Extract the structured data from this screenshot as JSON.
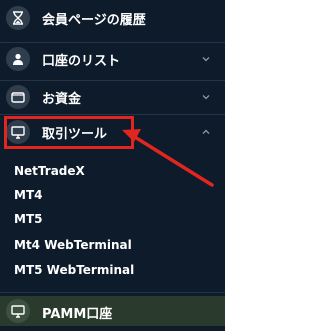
{
  "menu": {
    "items": [
      {
        "label": "会員ページの履歴",
        "icon": "hourglass-icon",
        "chevron": "none"
      },
      {
        "label": "口座のリスト",
        "icon": "people-icon",
        "chevron": "down"
      },
      {
        "label": "お資金",
        "icon": "wallet-icon",
        "chevron": "down"
      },
      {
        "label": "取引ツール",
        "icon": "monitor-icon",
        "chevron": "up"
      }
    ],
    "submenu": [
      "NetTradeX",
      "MT4",
      "MT5",
      "Mt4 WebTerminal",
      "MT5 WebTerminal"
    ],
    "pamm": {
      "label": "PAMM口座",
      "icon": "monitor-icon"
    }
  },
  "colors": {
    "sidebar_bg": "#0e1b2b",
    "highlight": "#e0261e",
    "pamm_bg": "#2a3a2c"
  }
}
